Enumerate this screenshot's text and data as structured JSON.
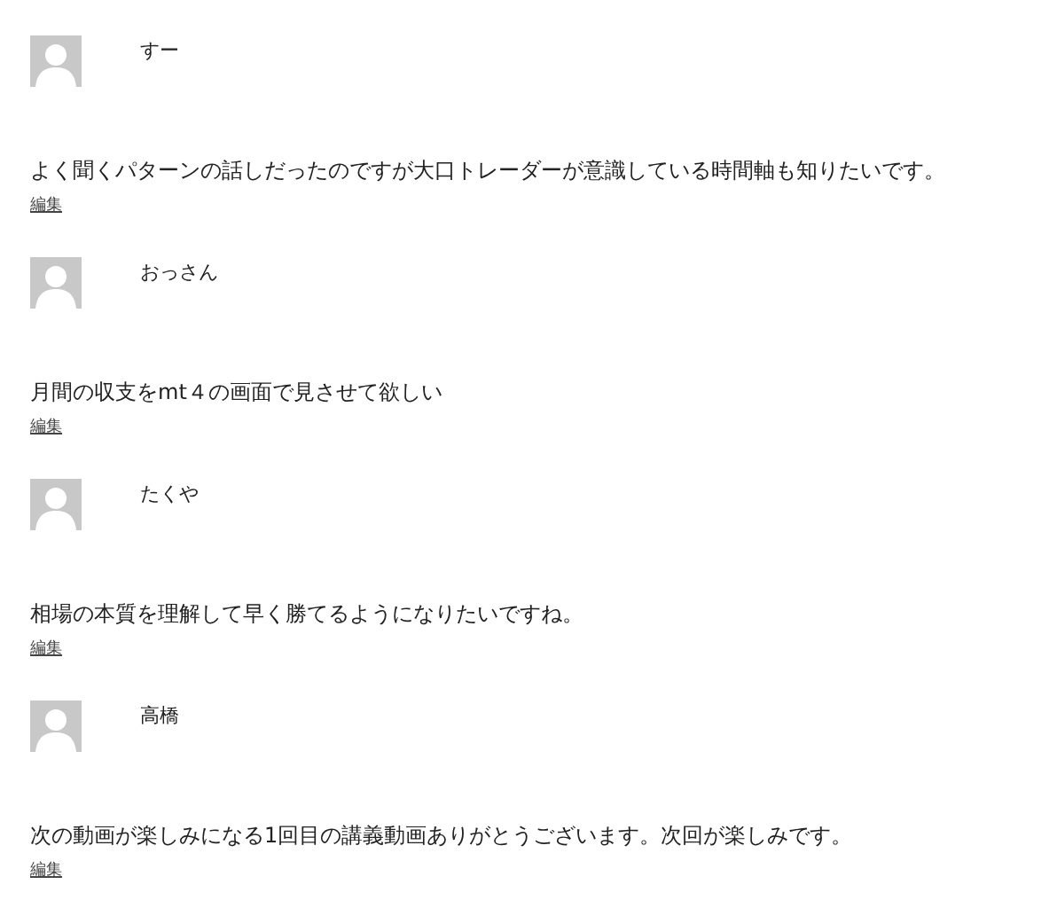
{
  "comments": [
    {
      "author": "すー",
      "text": "よく聞くパターンの話しだったのですが大口トレーダーが意識している時間軸も知りたいです。",
      "edit_link": "編集"
    },
    {
      "author": "おっさん",
      "text": "月間の収支をmt４の画面で見させて欲しい",
      "edit_link": "編集"
    },
    {
      "author": "たくや",
      "text": "相場の本質を理解して早く勝てるようになりたいですね。",
      "edit_link": "編集"
    },
    {
      "author": "高橋",
      "text": "次の動画が楽しみになる1回目の講義動画ありがとうございます。次回が楽しみです。",
      "edit_link": "編集"
    }
  ]
}
